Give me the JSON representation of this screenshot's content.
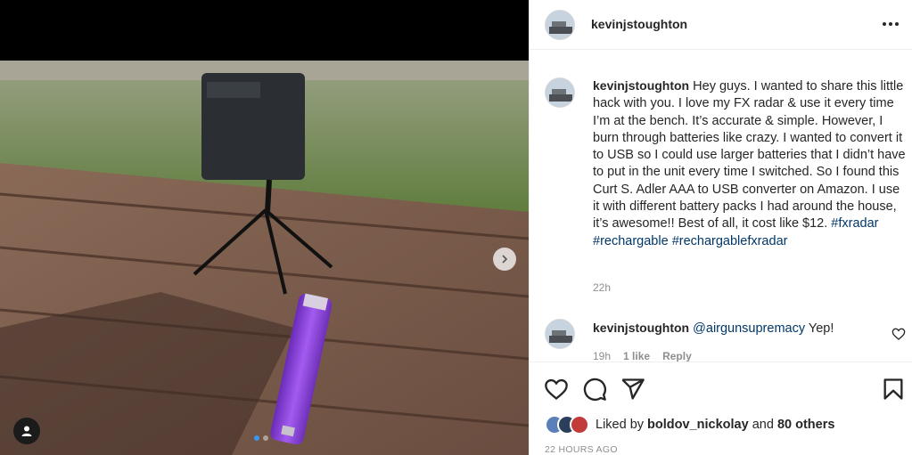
{
  "post": {
    "username": "kevinjstoughton",
    "more_label": "More options"
  },
  "caption": {
    "username": "kevinjstoughton",
    "text": "Hey guys. I wanted to share this little hack with you. I love my FX radar & use it every time I’m at the bench. It’s accurate & simple. However, I burn through batteries like crazy. I wanted to convert it to USB so I could use larger batteries that I didn’t have to put in the unit every time I switched. So I found this Curt S. Adler AAA to USB converter on Amazon. I use it with different battery packs I had around the house, it’s awesome!! Best of all, it cost like $12.",
    "hashtags": [
      "#fxradar",
      "#rechargable",
      "#rechargablefxradar"
    ],
    "time": "22h"
  },
  "reply": {
    "username": "kevinjstoughton",
    "mention": "@airgunsupremacy",
    "text": "Yep!",
    "time": "19h",
    "likes": "1 like",
    "reply_label": "Reply"
  },
  "likes": {
    "prefix": "Liked by",
    "user": "boldov_nickolay",
    "conj": "and",
    "others": "80 others"
  },
  "timestamp": "22 HOURS AGO",
  "carousel": {
    "current": 1,
    "total": 2
  },
  "colors": {
    "accent": "#3897f0",
    "hashtag": "#00376b",
    "muted": "#8e8e8e"
  },
  "icons": [
    "heart-icon",
    "comment-icon",
    "share-icon",
    "bookmark-icon",
    "more-icon",
    "chevron-right-icon",
    "user-tag-icon"
  ]
}
